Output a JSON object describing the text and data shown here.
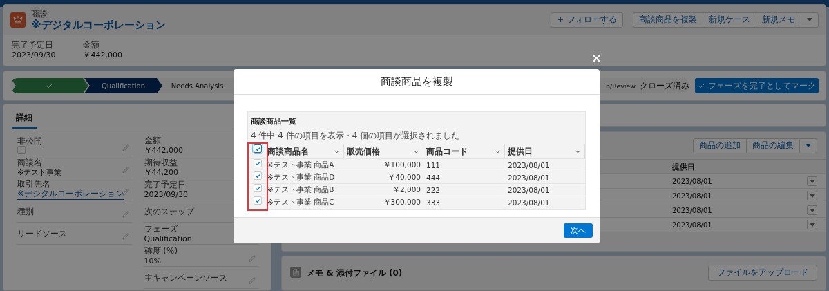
{
  "header": {
    "object_label": "商談",
    "title": "※デジタルコーポレーション",
    "follow_button": "フォローする",
    "actions": [
      "商談商品を複製",
      "新規ケース",
      "新規メモ"
    ]
  },
  "highlights": [
    {
      "label": "完了予定日",
      "value": "2023/09/30"
    },
    {
      "label": "金額",
      "value": "￥442,000"
    }
  ],
  "path": {
    "stages": [
      {
        "complete": true,
        "selected": false
      },
      {
        "complete": false,
        "selected": true,
        "label": "Qualification"
      },
      {
        "complete": false,
        "selected": false,
        "label": "Needs Analysis"
      },
      {
        "complete": false,
        "selected": false,
        "label": "n/Review",
        "clipped": true
      },
      {
        "complete": false,
        "selected": false,
        "label": "クローズ済み"
      }
    ],
    "mark_button": "フェーズを完了としてマーク"
  },
  "details": {
    "tabs": [
      {
        "label": "詳細",
        "selected": true
      }
    ],
    "columns": [
      [
        {
          "label": "非公開",
          "kind": "checkbox",
          "checked": false,
          "editable": true
        },
        {
          "label": "商談名",
          "kind": "text",
          "value": "※テスト事業",
          "editable": true
        },
        {
          "label": "取引先名",
          "kind": "link",
          "value": "※デジタルコーポレーション",
          "editable": true
        },
        {
          "label": "種別",
          "kind": "text",
          "editable": true
        },
        {
          "label": "リードソース",
          "kind": "text",
          "editable": true
        }
      ],
      [
        {
          "label": "金額",
          "kind": "text",
          "value": "￥442,000"
        },
        {
          "label": "期待収益",
          "kind": "text",
          "value": "￥44,200"
        },
        {
          "label": "完了予定日",
          "kind": "text",
          "value": "2023/09/30"
        },
        {
          "label": "次のステップ",
          "kind": "text"
        },
        {
          "label": "フェーズ",
          "kind": "text",
          "value": "Qualification"
        },
        {
          "label": "確度 (%)",
          "kind": "text",
          "value": "10%",
          "editable": true
        },
        {
          "label": "主キャンペーンソース",
          "kind": "text",
          "editable": true
        }
      ]
    ]
  },
  "products": {
    "buttons": [
      "商品の追加",
      "商品の編集"
    ],
    "column": "提供日",
    "rows": [
      {
        "date": "2023/08/01"
      },
      {
        "date": "2023/08/01"
      },
      {
        "date": "2023/08/01"
      },
      {
        "date": "2023/08/01"
      }
    ]
  },
  "notes": {
    "title": "メモ & 添付ファイル (0)",
    "upload_button": "ファイルをアップロード"
  },
  "modal": {
    "title": "商談商品を複製",
    "list_title": "商談商品一覧",
    "summary": "4 件中 4 件の項目を表示・4 個の項目が選択されました",
    "select_all_checked": true,
    "columns": [
      {
        "label": "商談商品名"
      },
      {
        "label": "販売価格"
      },
      {
        "label": "商品コード"
      },
      {
        "label": "提供日"
      }
    ],
    "rows": [
      {
        "name": "※テスト事業 商品A",
        "price": "￥100,000",
        "code": "111",
        "date": "2023/08/01",
        "checked": true
      },
      {
        "name": "※テスト事業 商品D",
        "price": "￥40,000",
        "code": "444",
        "date": "2023/08/01",
        "checked": true
      },
      {
        "name": "※テスト事業 商品B",
        "price": "￥2,000",
        "code": "222",
        "date": "2023/08/01",
        "checked": true
      },
      {
        "name": "※テスト事業 商品C",
        "price": "￥300,000",
        "code": "333",
        "date": "2023/08/01",
        "checked": true
      }
    ],
    "next_button": "次へ"
  }
}
